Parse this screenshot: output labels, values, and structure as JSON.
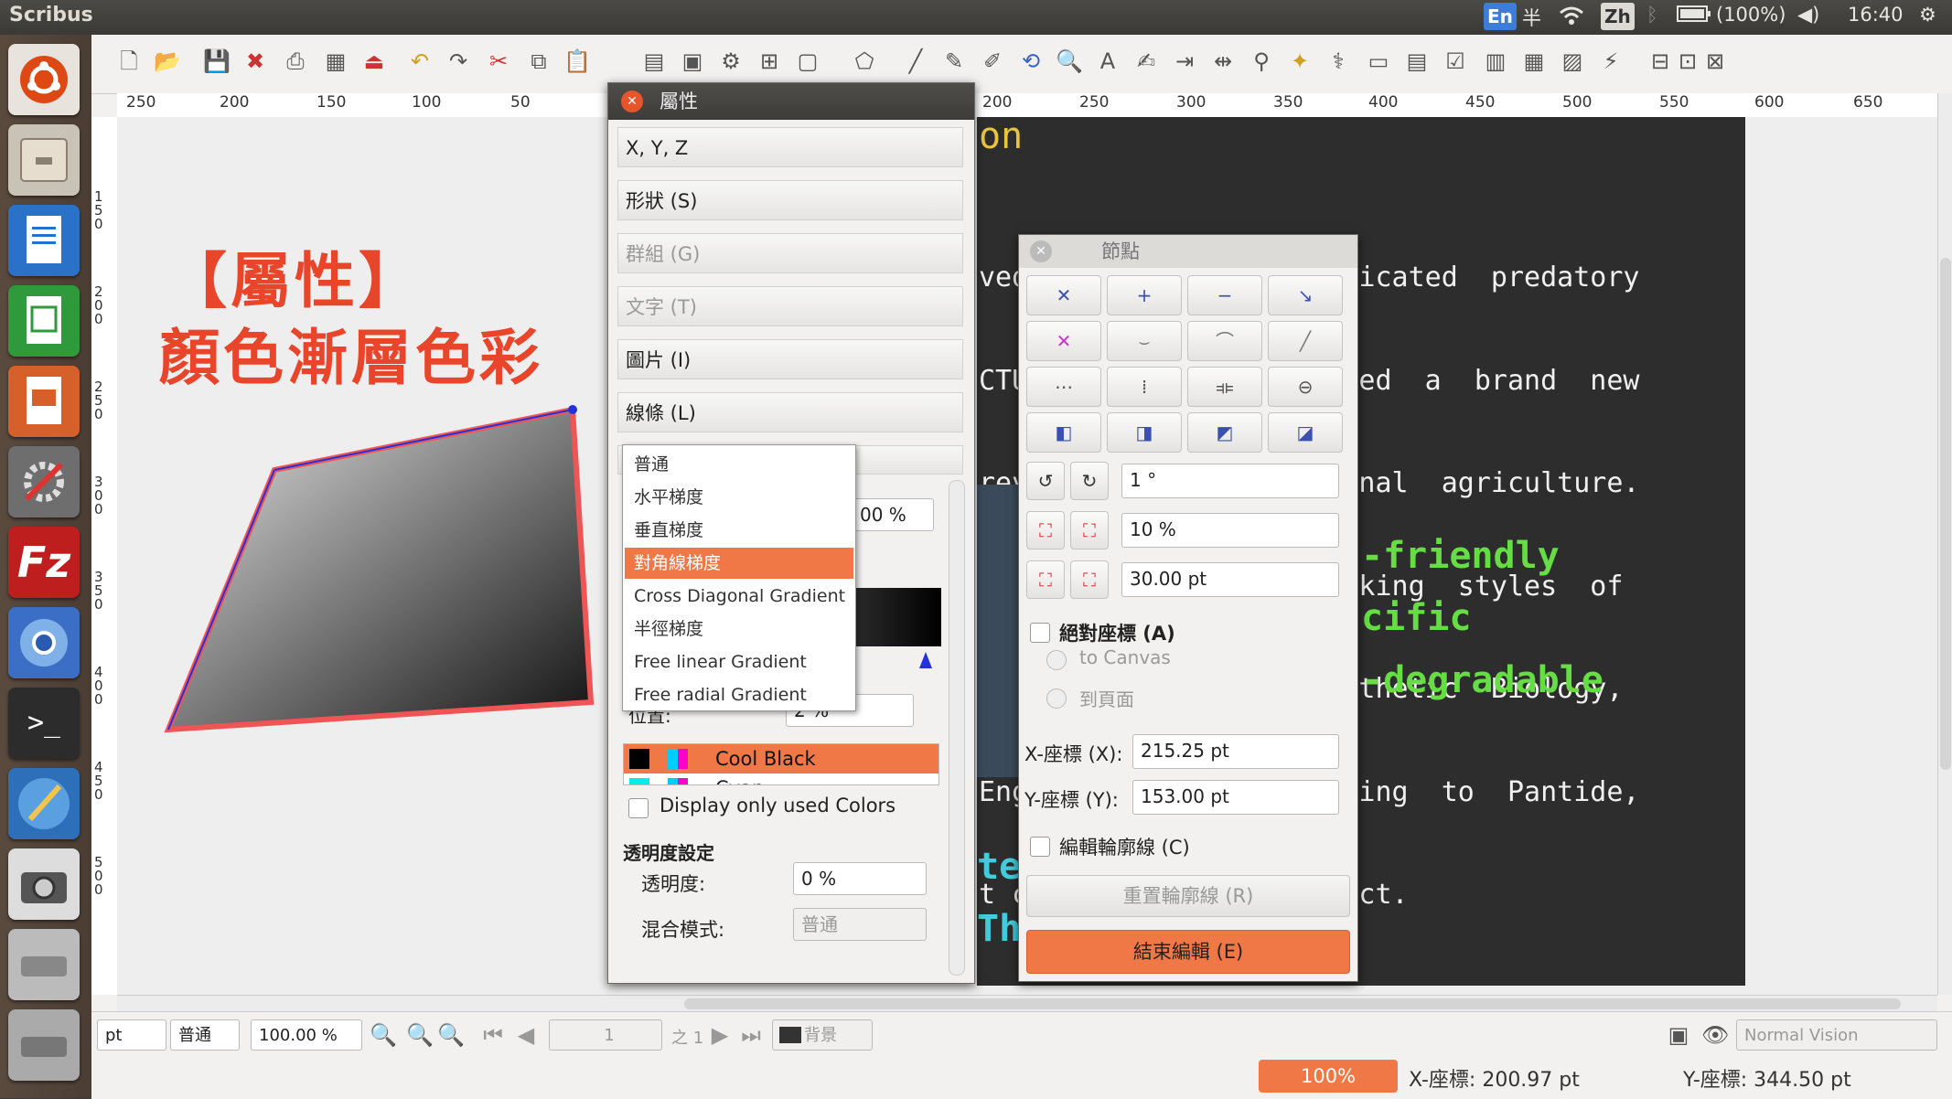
{
  "top_panel": {
    "app_title": "Scribus",
    "lang_en": "En",
    "input_mode": "半",
    "lang_zh": "Zh",
    "battery": "(100%)",
    "time": "16:40"
  },
  "ruler": {
    "h_labels": [
      "250",
      "200",
      "150",
      "100",
      "50",
      "",
      "200",
      "250",
      "300",
      "350",
      "400",
      "450",
      "500",
      "550",
      "600",
      "650"
    ],
    "v_labels": [
      "150",
      "200",
      "250",
      "300",
      "350",
      "400",
      "450",
      "500"
    ]
  },
  "canvas": {
    "heading": "【屬性】",
    "subheading": "顏色漸層色彩",
    "doc_title_fragment": "on",
    "doc_lines": [
      "ved  genuinely  sophisticated  predatory",
      "CTU                  ated  a  brand  new",
      "rev                  ional  agriculture.",
      " fo                 working  styles  of",
      "e                    ynthetic  Biology,",
      "Eng                  nding  to  Pantide,",
      "t c                 oject."
    ],
    "green_lines": [
      "-friendly",
      "cific",
      "-degradable"
    ],
    "cyan_fragments": [
      "te",
      "Thi"
    ]
  },
  "properties": {
    "title": "屬性",
    "sections": [
      "X, Y, Z",
      "形狀 (S)",
      "群組 (G)",
      "文字 (T)",
      "圖片 (I)",
      "線條 (L)"
    ],
    "disabled_sections": [
      2,
      3
    ],
    "gradient_options": [
      "普通",
      "水平梯度",
      "垂直梯度",
      "對角線梯度",
      "Cross Diagonal Gradient",
      "半徑梯度",
      "Free linear Gradient",
      "Free radial Gradient"
    ],
    "selected_gradient": 3,
    "percent_value": "00 %",
    "position_label": "位置:",
    "position_value": "2 %",
    "colors": [
      "Cool Black",
      "Cyan"
    ],
    "display_used_label": "Display only used Colors",
    "transparency_header": "透明度設定",
    "opacity_label": "透明度:",
    "opacity_value": "0 %",
    "blend_label": "混合模式:",
    "blend_value": "普通"
  },
  "nodes": {
    "title": "節點",
    "rotate_value": "1 °",
    "scale_value": "10 %",
    "size_value": "30.00 pt",
    "absolute_coords_label": "絕對座標 (A)",
    "to_canvas": "to Canvas",
    "to_page": "到頁面",
    "x_label": "X-座標 (X):",
    "x_value": "215.25 pt",
    "y_label": "Y-座標 (Y):",
    "y_value": "153.00 pt",
    "edit_contour_label": "編輯輪廓線 (C)",
    "reset_contour": "重置輪廓線 (R)",
    "end_edit": "結束編輯 (E)"
  },
  "statusbar": {
    "unit": "pt",
    "mode": "普通",
    "zoom": "100.00 %",
    "page": "1",
    "page_of": "之 1",
    "layer": "背景",
    "vision": "Normal Vision",
    "progress": "100%",
    "x_coord": "X-座標: 200.97 pt",
    "y_coord": "Y-座標: 344.50 pt"
  },
  "colors": {
    "accent": "#f07746",
    "heading_red": "#e8452b",
    "shape_outline": "#f05555",
    "green_text": "#66dd44",
    "cyan_text": "#44ccdd"
  }
}
